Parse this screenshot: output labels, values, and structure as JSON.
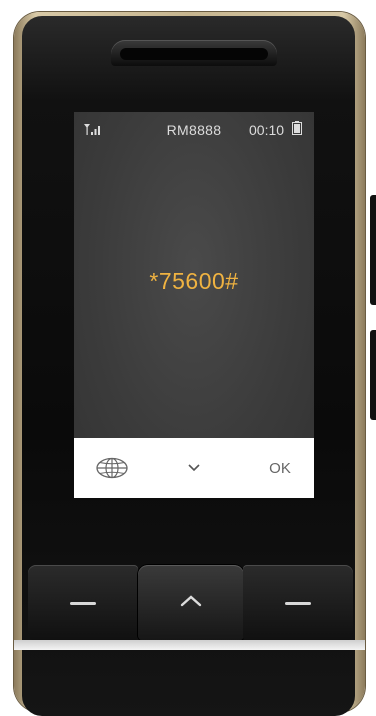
{
  "status_bar": {
    "carrier": "RM8888",
    "time": "00:10",
    "signal_icon": "signal-bars-icon",
    "battery_icon": "battery-icon"
  },
  "dialer": {
    "input_text": "*75600#",
    "text_color": "#f0b341"
  },
  "softkeys": {
    "left_icon": "globe-icon",
    "center_icon": "chevron-down-icon",
    "right_label": "OK"
  },
  "hardware_keys": {
    "left_icon": "dash-icon",
    "center_icon": "chevron-up-icon",
    "right_icon": "dash-icon"
  }
}
